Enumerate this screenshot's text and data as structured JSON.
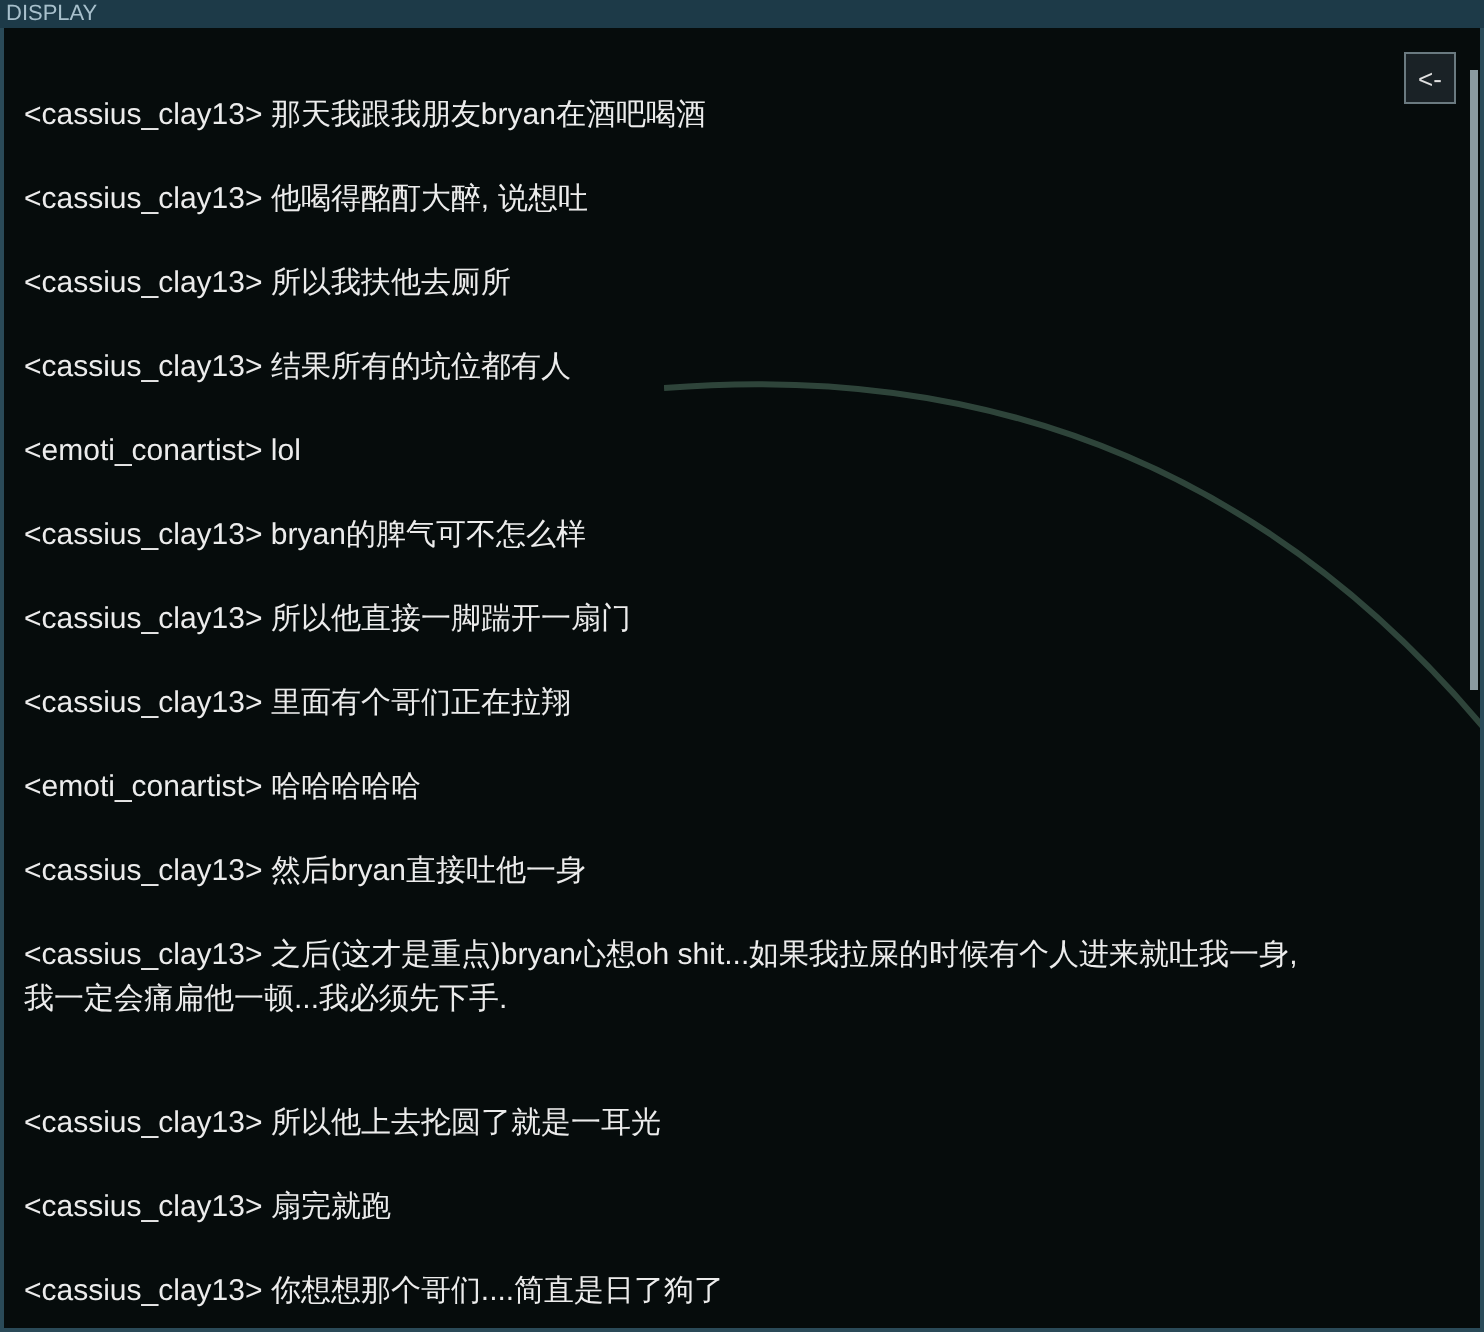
{
  "panel": {
    "title": "DISPLAY"
  },
  "back_button": {
    "label": "<-"
  },
  "messages": [
    {
      "sender": "<cassius_clay13>",
      "text": "那天我跟我朋友bryan在酒吧喝酒",
      "trailing_blank": false
    },
    {
      "sender": "<cassius_clay13>",
      "text": "他喝得酩酊大醉, 说想吐",
      "trailing_blank": false
    },
    {
      "sender": "<cassius_clay13>",
      "text": "所以我扶他去厕所",
      "trailing_blank": false
    },
    {
      "sender": "<cassius_clay13>",
      "text": "结果所有的坑位都有人",
      "trailing_blank": false
    },
    {
      "sender": "<emoti_conartist>",
      "text": "lol",
      "trailing_blank": false
    },
    {
      "sender": "<cassius_clay13>",
      "text": "bryan的脾气可不怎么样",
      "trailing_blank": false
    },
    {
      "sender": "<cassius_clay13>",
      "text": "所以他直接一脚踹开一扇门",
      "trailing_blank": false
    },
    {
      "sender": "<cassius_clay13>",
      "text": "里面有个哥们正在拉翔",
      "trailing_blank": false
    },
    {
      "sender": "<emoti_conartist>",
      "text": "哈哈哈哈哈",
      "trailing_blank": false
    },
    {
      "sender": "<cassius_clay13>",
      "text": "然后bryan直接吐他一身",
      "trailing_blank": false
    },
    {
      "sender": "<cassius_clay13>",
      "text": "之后(这才是重点)bryan心想oh shit...如果我拉屎的时候有个人进来就吐我一身, 我一定会痛扁他一顿...我必须先下手.",
      "trailing_blank": true
    },
    {
      "sender": "<cassius_clay13>",
      "text": "所以他上去抡圆了就是一耳光",
      "trailing_blank": false
    },
    {
      "sender": "<cassius_clay13>",
      "text": "扇完就跑",
      "trailing_blank": false
    },
    {
      "sender": "<cassius_clay13>",
      "text": "你想想那个哥们....简直是日了狗了",
      "trailing_blank": false
    }
  ]
}
